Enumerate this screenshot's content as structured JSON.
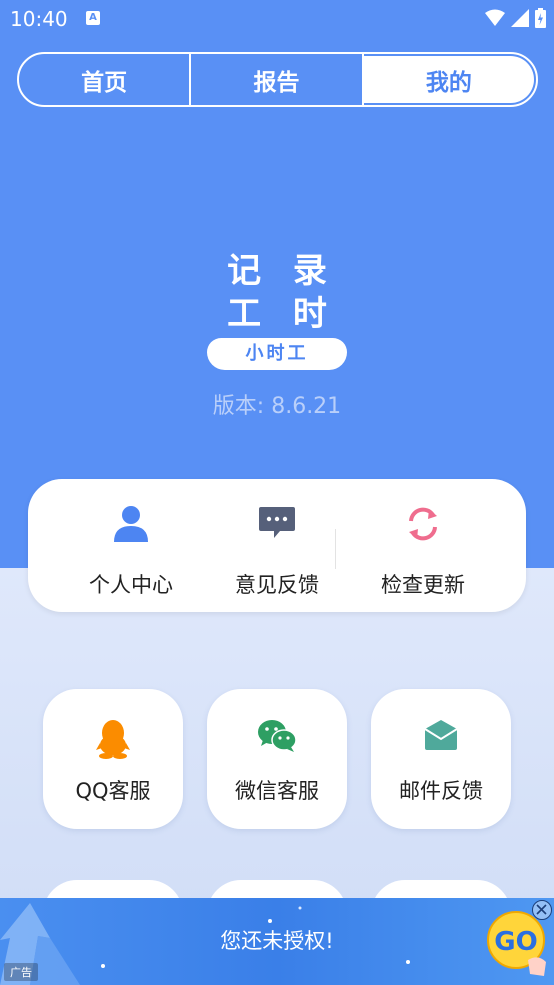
{
  "status_bar": {
    "time": "10:40",
    "notification_icon": "A"
  },
  "tabs": [
    {
      "label": "首页",
      "active": false
    },
    {
      "label": "报告",
      "active": false
    },
    {
      "label": "我的",
      "active": true
    }
  ],
  "logo": {
    "line1": "记 录",
    "line2": "工 时",
    "badge": "小时工"
  },
  "version": "版本: 8.6.21",
  "actions": [
    {
      "label": "个人中心",
      "icon": "person-icon"
    },
    {
      "label": "意见反馈",
      "icon": "chat-bubble-icon"
    },
    {
      "label": "检查更新",
      "icon": "refresh-icon"
    }
  ],
  "support": [
    {
      "label": "QQ客服",
      "icon": "qq-penguin-icon"
    },
    {
      "label": "微信客服",
      "icon": "wechat-icon"
    },
    {
      "label": "邮件反馈",
      "icon": "mail-icon"
    }
  ],
  "ad": {
    "text": "您还未授权!",
    "tag": "广告",
    "go_label": "GO"
  },
  "colors": {
    "primary": "#5990f5",
    "accent_text": "#4d85f2",
    "qq_orange": "#fb8c00",
    "wechat_green": "#2e9f63",
    "mail_teal": "#4fa99b",
    "refresh_pink": "#ef6d8e"
  }
}
